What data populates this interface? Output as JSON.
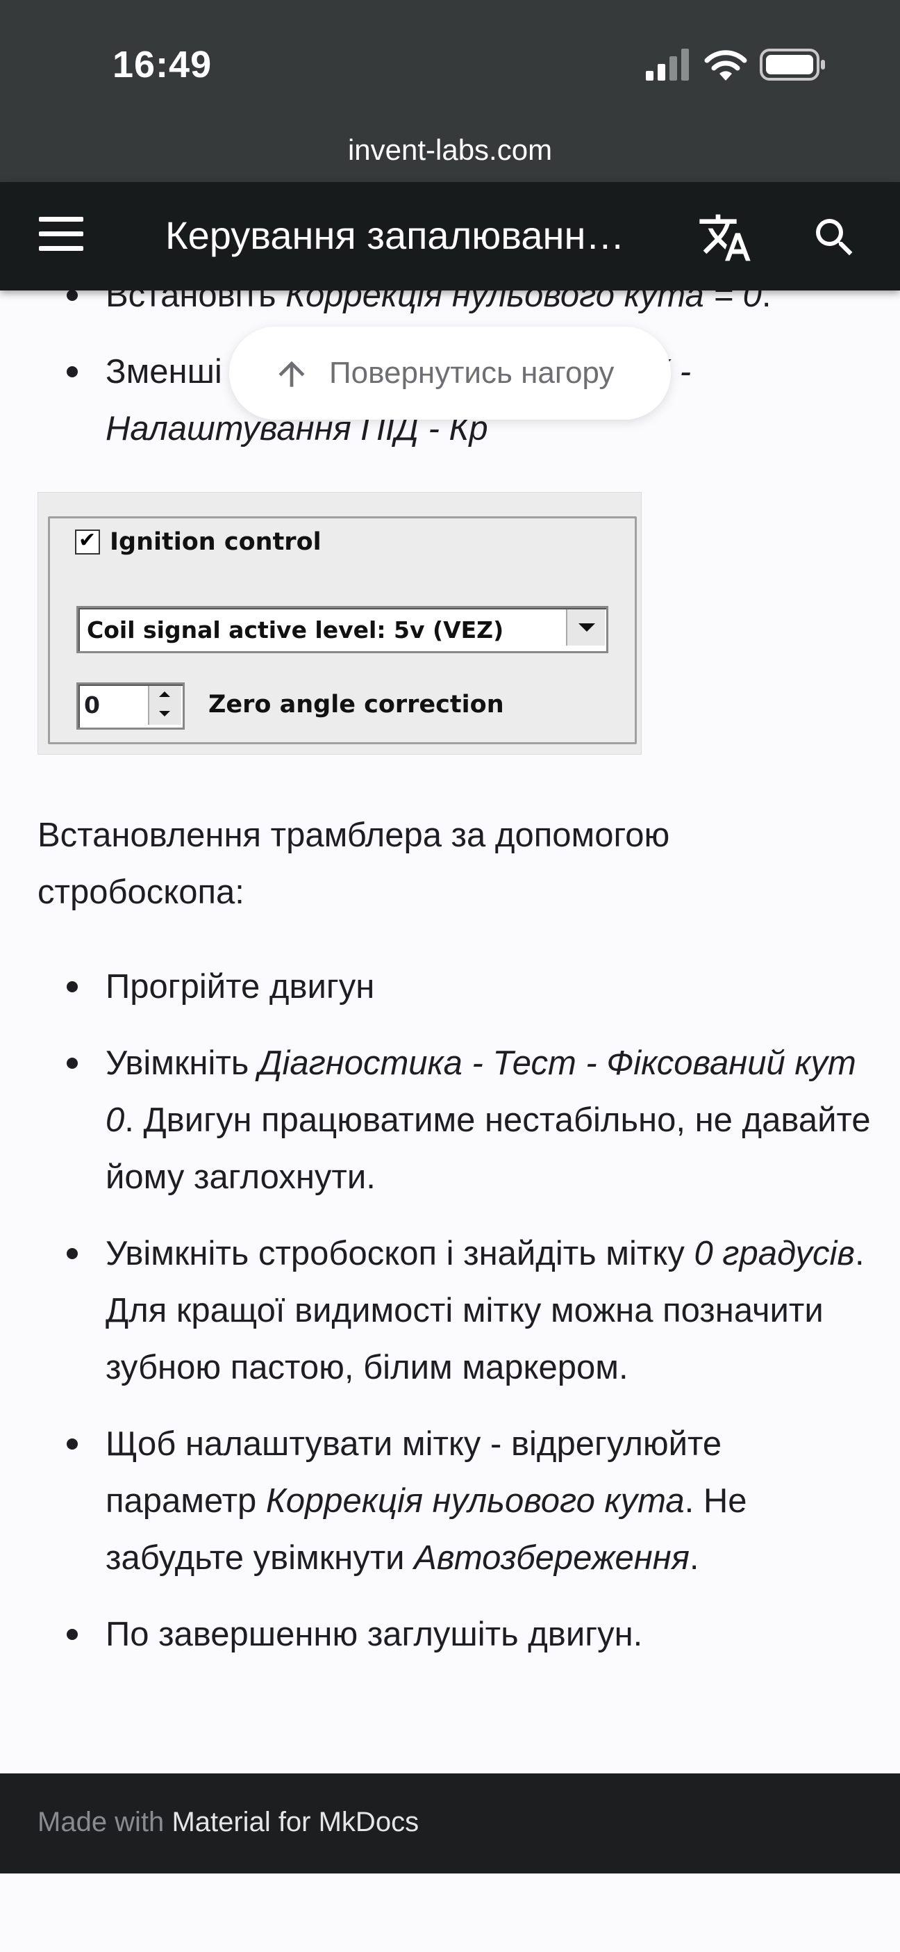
{
  "status_bar": {
    "time": "16:49"
  },
  "browser": {
    "url": "invent-labs.com"
  },
  "header": {
    "title": "Керування запалюванн…",
    "icons": [
      "menu-icon",
      "translate-icon",
      "search-icon"
    ]
  },
  "back_to_top": {
    "label": "Повернутись нагору"
  },
  "top_list": [
    {
      "plain": "Встановіть ",
      "em": "Коррекція нульового кута = 0",
      "tail": "."
    },
    {
      "plain": "Зменші",
      "tail_hidden": "XX -",
      "em2": "Налаштування ПІД - Кр"
    }
  ],
  "screenshot": {
    "group_label": "Ignition control",
    "checked": true,
    "select_value": "Coil signal active level: 5v (VEZ)",
    "number_value": "0",
    "number_label": "Zero angle correction"
  },
  "paragraph": "Встановлення трамблера за допомогою стробоскопа:",
  "steps": {
    "s1": "Прогрійте двигун",
    "s2a": "Увімкніть ",
    "s2em": "Діагностика - Тест - Фіксований кут 0",
    "s2b": ". Двигун працюватиме нестабільно, не давайте йому заглохнути.",
    "s3a": "Увімкніть стробоскоп і знайдіть мітку ",
    "s3em": "0 градусів",
    "s3b": ". Для кращої видимості мітку можна позначити зубною пастою, білим маркером.",
    "s4a": "Щоб налаштувати мітку - відрегулюйте параметр ",
    "s4em": "Коррекція нульового кута",
    "s4b": ". Не забудьте увімкнути ",
    "s4em2": "Автозбереження",
    "s4c": ".",
    "s5": "По завершенню заглушіть двигун."
  },
  "footer": {
    "made_with": "Made with",
    "link": "Material for MkDocs"
  }
}
